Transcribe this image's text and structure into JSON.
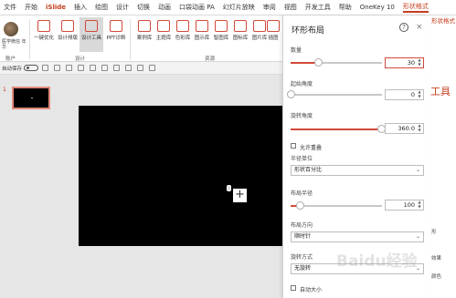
{
  "menu": [
    "文件",
    "开始",
    "iSlide",
    "插入",
    "绘图",
    "设计",
    "切换",
    "动画",
    "口袋动画 PA",
    "幻灯片放映",
    "审阅",
    "视图",
    "开发工具",
    "帮助",
    "OneKey 10",
    "形状格式"
  ],
  "account": {
    "name": "医学微信 年华",
    "group": "账户"
  },
  "ribbon": {
    "design_buttons": [
      "一键优化",
      "设计排版",
      "设计工具",
      "PPT诊断"
    ],
    "design_group": "设计",
    "resource_buttons": [
      "案例库",
      "主题库",
      "色彩库",
      "图示库",
      "智图库",
      "图标库",
      "图片库",
      "插图"
    ],
    "resource_group": "资源"
  },
  "qat": {
    "autosave": "自动保存",
    "toggle": "关"
  },
  "thumbnail": {
    "number": "1"
  },
  "right_pane": {
    "tab": "形状格式",
    "tools_label": "工具",
    "labels": [
      "形",
      "效果",
      "颜色"
    ]
  },
  "panel": {
    "title": "环形布局",
    "help": "?",
    "close": "×",
    "count": {
      "label": "数量",
      "value": "30",
      "fill": 0.3
    },
    "start_angle": {
      "label": "起始角度",
      "value": "0",
      "fill": 0.0
    },
    "sweep_angle": {
      "label": "旋转角度",
      "value": "360.0",
      "fill": 1.0
    },
    "allow_overlap": {
      "label": "允许重叠"
    },
    "layout_mode": {
      "label": "半径单位",
      "value": "形状百分比"
    },
    "radius": {
      "label": "布局半径",
      "value": "100",
      "fill": 0.1
    },
    "direction": {
      "label": "布局方向",
      "value": "顺时针"
    },
    "rotation": {
      "label": "旋转方式",
      "value": "无旋转"
    },
    "auto_size": {
      "label": "自动大小"
    }
  },
  "watermark": "Baidu经验",
  "colors": {
    "accent": "#d24a3a",
    "islide": "#c43e1c"
  }
}
